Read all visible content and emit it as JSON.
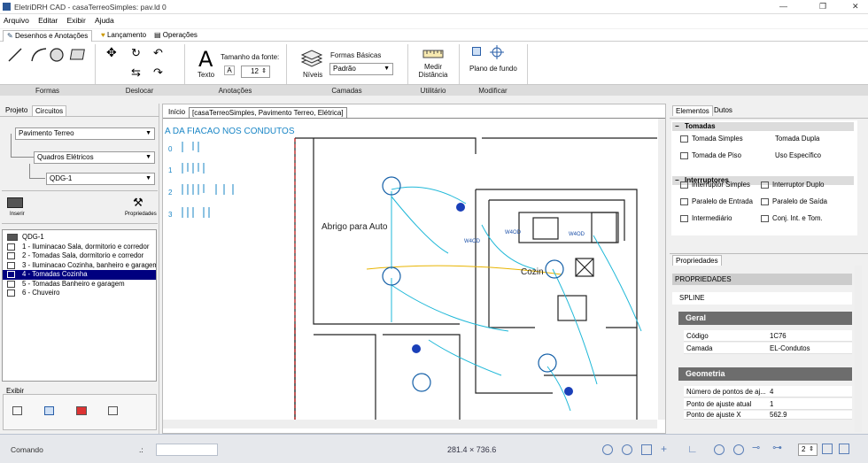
{
  "window": {
    "title": "EletriDRH CAD - casaTerreoSimples: pav.ld 0"
  },
  "menu": [
    "Arquivo",
    "Editar",
    "Exibir",
    "Ajuda"
  ],
  "ribbon_tabs": [
    "Desenhos e Anotações",
    "Lançamento",
    "Operações"
  ],
  "ribbon": {
    "font_size_label": "Tamanho da fonte:",
    "font_size_value": "12",
    "text_label": "Texto",
    "shapes_label": "Formas Básicas",
    "shapes_value": "Padrão",
    "levels_label": "Níveis",
    "measure_label": "Medir\nDistância",
    "background_label": "Plano de fundo",
    "groups": [
      "Formas",
      "Deslocar",
      "Anotações",
      "Camadas",
      "Utilitário",
      "Modificar"
    ]
  },
  "left": {
    "tabs": [
      "Projeto",
      "Circuitos"
    ],
    "floor": "Pavimento Terreo",
    "panel_type": "Quadros Elétricos",
    "panel": "QDG-1",
    "insert_label": "Inserir",
    "props_label": "Propriedades",
    "tree_root": "QDG-1",
    "circuits": [
      "1 - Iluminacao Sala, dormitorio e corredor",
      "2 - Tomadas Sala, dormitorio e corredor",
      "3 - Iluminacao Cozinha, banheiro e garagem",
      "4 - Tomadas Cozinha",
      "5 - Tomadas Banheiro e garagem",
      "6 - Chuveiro"
    ],
    "show_label": "Exibir"
  },
  "canvas": {
    "tabs": [
      "Início",
      "[casaTerreoSimples, Pavimento Terreo, Elétrica]"
    ],
    "legend_title": "A DA FIACAO NOS CONDUTOS",
    "legend_rows": [
      "0",
      "1",
      "2",
      "3"
    ],
    "room1": "Abrigo para Auto",
    "room2": "Cozin"
  },
  "right": {
    "tabs": [
      "Elementos",
      "Dutos"
    ],
    "sec1": "Tomadas",
    "items1": [
      "Tomada Simples",
      "Tomada Dupla",
      "Tomada de Piso",
      "Uso Específico"
    ],
    "sec2": "Interruptores",
    "items2": [
      "Interruptor Simples",
      "Interruptor Duplo",
      "Paralelo de Entrada",
      "Paralelo de Saída",
      "Intermediário",
      "Conj. Int. e Tom."
    ],
    "props_tab": "Propriedades",
    "props_header": "PROPRIEDADES",
    "type": "SPLINE",
    "group_geral": "Geral",
    "codigo_k": "Código",
    "codigo_v": "1C76",
    "camada_k": "Camada",
    "camada_v": "EL-Condutos",
    "group_geom": "Geometria",
    "npts_k": "Número de pontos de aj...",
    "npts_v": "4",
    "cur_k": "Ponto de ajuste atual",
    "cur_v": "1",
    "px_k": "Ponto de ajuste X",
    "px_v": "562.9"
  },
  "status": {
    "command_label": "Comando",
    "sep": ".:",
    "coords": "281.4 × 736.6",
    "layer": "2"
  }
}
